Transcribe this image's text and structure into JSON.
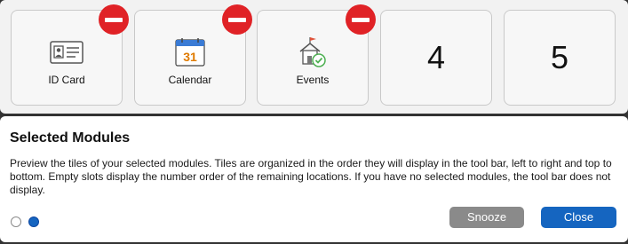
{
  "tiles": [
    {
      "label": "ID Card",
      "icon": "id-card-icon",
      "removable": true
    },
    {
      "label": "Calendar",
      "icon": "calendar-icon",
      "calendar_day": "31",
      "removable": true
    },
    {
      "label": "Events",
      "icon": "events-icon",
      "removable": true
    },
    {
      "number": "4",
      "removable": false
    },
    {
      "number": "5",
      "removable": false
    }
  ],
  "modal": {
    "title": "Selected Modules",
    "description": "Preview the tiles of your selected modules. Tiles are organized in the order they will display in the tool bar, left to right and top to bottom. Empty slots display the number order of the remaining locations. If you have no selected modules, the tool bar does not display.",
    "snooze_label": "Snooze",
    "close_label": "Close",
    "pagination": {
      "total": 2,
      "current": 2
    }
  },
  "colors": {
    "remove": "#e02226",
    "primary": "#1565c0",
    "secondary": "#8a8a8a",
    "calendar_header": "#3a7bd5",
    "calendar_day": "#e07b00",
    "event_flag": "#e0533a",
    "event_check": "#4caf50"
  }
}
